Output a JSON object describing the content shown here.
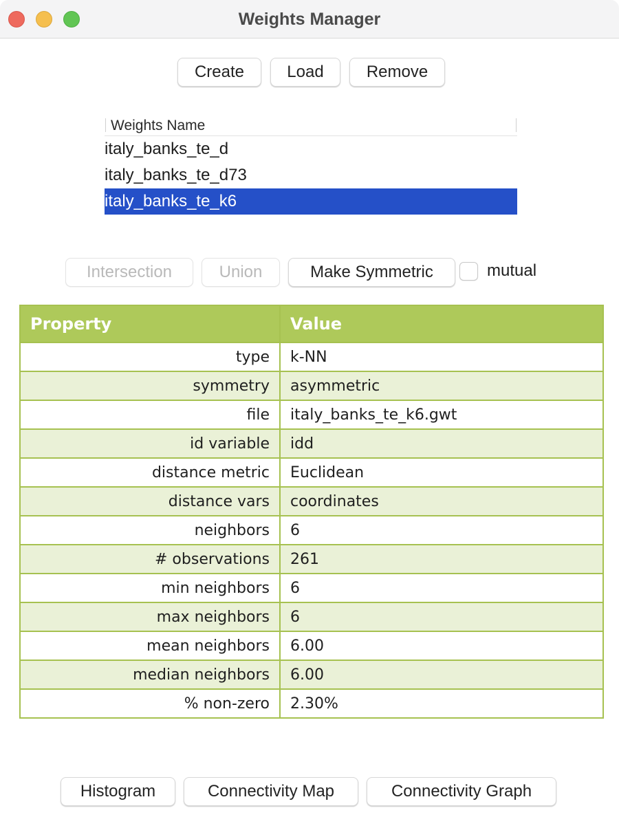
{
  "window": {
    "title": "Weights Manager",
    "controls": [
      "close",
      "minimize",
      "maximize"
    ]
  },
  "toolbar": {
    "create_label": "Create",
    "load_label": "Load",
    "remove_label": "Remove"
  },
  "weights_list": {
    "header": "Weights Name",
    "items": [
      {
        "name": "italy_banks_te_d",
        "selected": false
      },
      {
        "name": "italy_banks_te_d73",
        "selected": false
      },
      {
        "name": "italy_banks_te_k6",
        "selected": true
      }
    ],
    "selection_color": "#2550c8"
  },
  "operations": {
    "intersection_label": "Intersection",
    "intersection_enabled": false,
    "union_label": "Union",
    "union_enabled": false,
    "make_symmetric_label": "Make Symmetric",
    "make_symmetric_enabled": true,
    "mutual_label": "mutual",
    "mutual_checked": false
  },
  "properties": {
    "header_property": "Property",
    "header_value": "Value",
    "header_color": "#aec95a",
    "stripe_color": "#eaf1d7",
    "rows": [
      {
        "property": "type",
        "value": "k-NN"
      },
      {
        "property": "symmetry",
        "value": "asymmetric"
      },
      {
        "property": "file",
        "value": "italy_banks_te_k6.gwt"
      },
      {
        "property": "id variable",
        "value": "idd"
      },
      {
        "property": "distance metric",
        "value": "Euclidean"
      },
      {
        "property": "distance vars",
        "value": "coordinates"
      },
      {
        "property": "neighbors",
        "value": "6"
      },
      {
        "property": "# observations",
        "value": "261"
      },
      {
        "property": "min neighbors",
        "value": "6"
      },
      {
        "property": "max neighbors",
        "value": "6"
      },
      {
        "property": "mean neighbors",
        "value": "6.00"
      },
      {
        "property": "median neighbors",
        "value": "6.00"
      },
      {
        "property": "% non-zero",
        "value": "2.30%"
      }
    ]
  },
  "bottom_buttons": {
    "histogram_label": "Histogram",
    "connectivity_map_label": "Connectivity Map",
    "connectivity_graph_label": "Connectivity Graph"
  }
}
